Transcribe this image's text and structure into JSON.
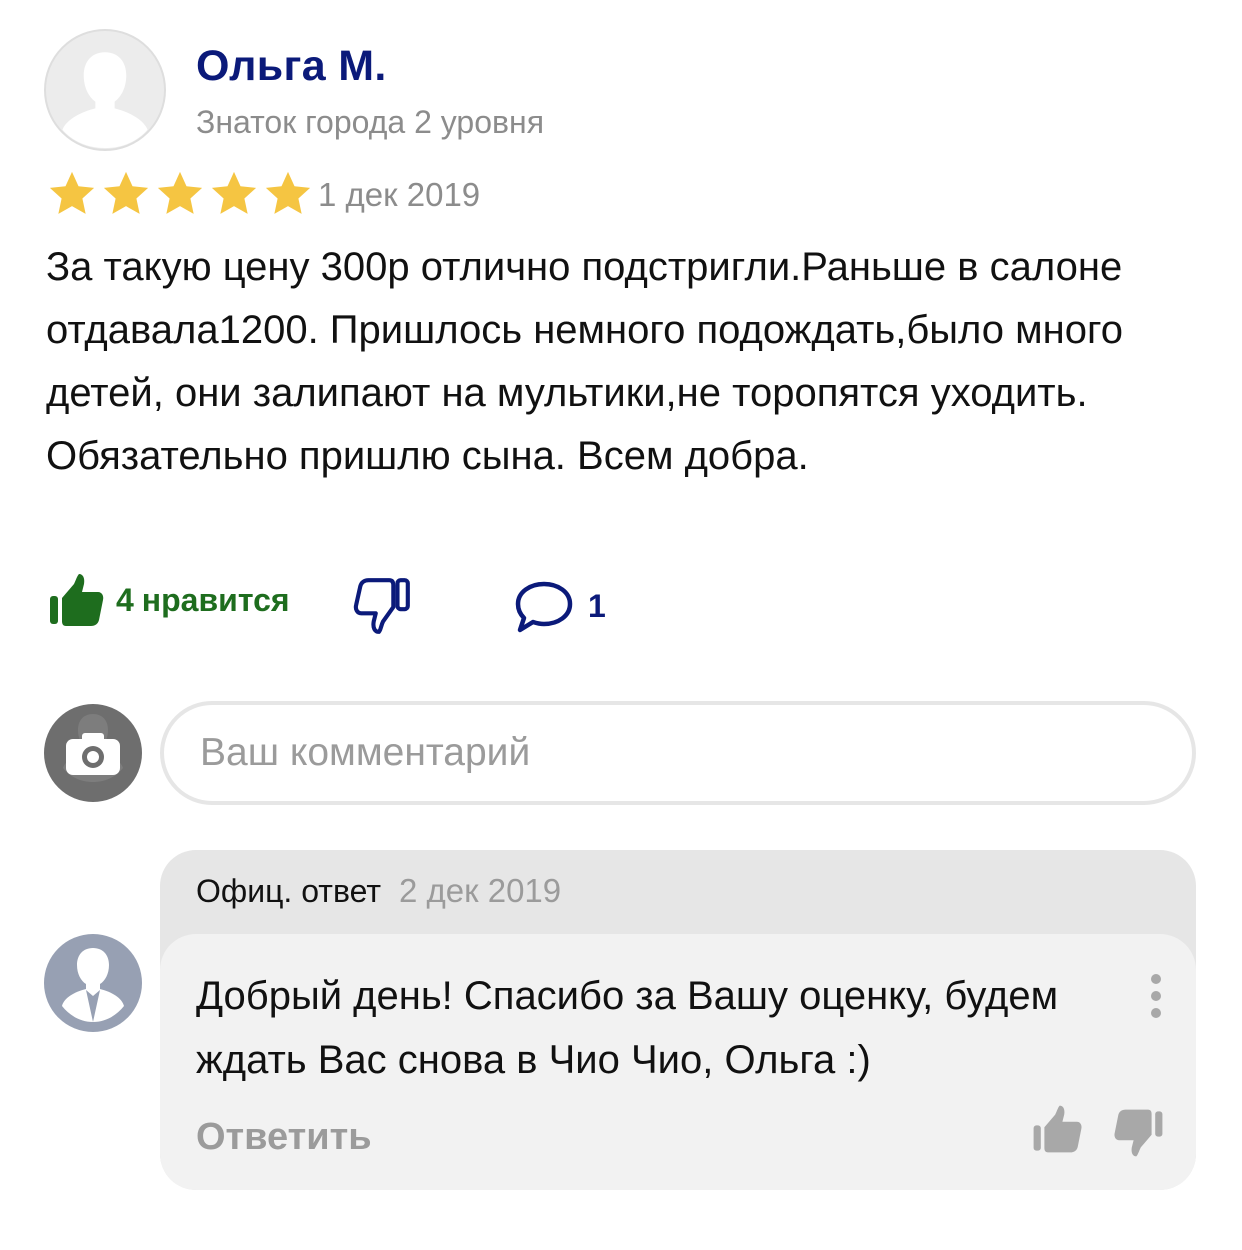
{
  "review": {
    "author_name": "Ольга М.",
    "author_level": "Знаток города 2 уровня",
    "rating": 5,
    "rating_max": 5,
    "star_color": "#f5c542",
    "date": "1 дек 2019",
    "text": "За такую цену 300р отлично подстригли.Раньше в салоне отдавала1200. Пришлось немного подождать,было много детей, они залипают на мультики,не торопятся уходить. Обязательно пришлю сына. Всем добра."
  },
  "actions": {
    "like_count": "4",
    "like_label": "нравится",
    "like_color": "#1e6d1e",
    "comment_count": "1",
    "link_color": "#0b1a7a"
  },
  "comment_input": {
    "placeholder": "Ваш комментарий"
  },
  "official_reply": {
    "label": "Офиц. ответ",
    "date": "2 дек 2019",
    "text": "Добрый день! Спасибо за Вашу оценку, будем ждать Вас снова в Чио Чио, Ольга :)",
    "reply_action": "Ответить"
  },
  "icons": {
    "avatar": "user-silhouette-icon",
    "star": "star-icon",
    "like": "thumbs-up-icon",
    "dislike": "thumbs-down-icon",
    "comment": "speech-bubble-icon",
    "camera": "camera-icon",
    "more": "more-vertical-icon"
  }
}
